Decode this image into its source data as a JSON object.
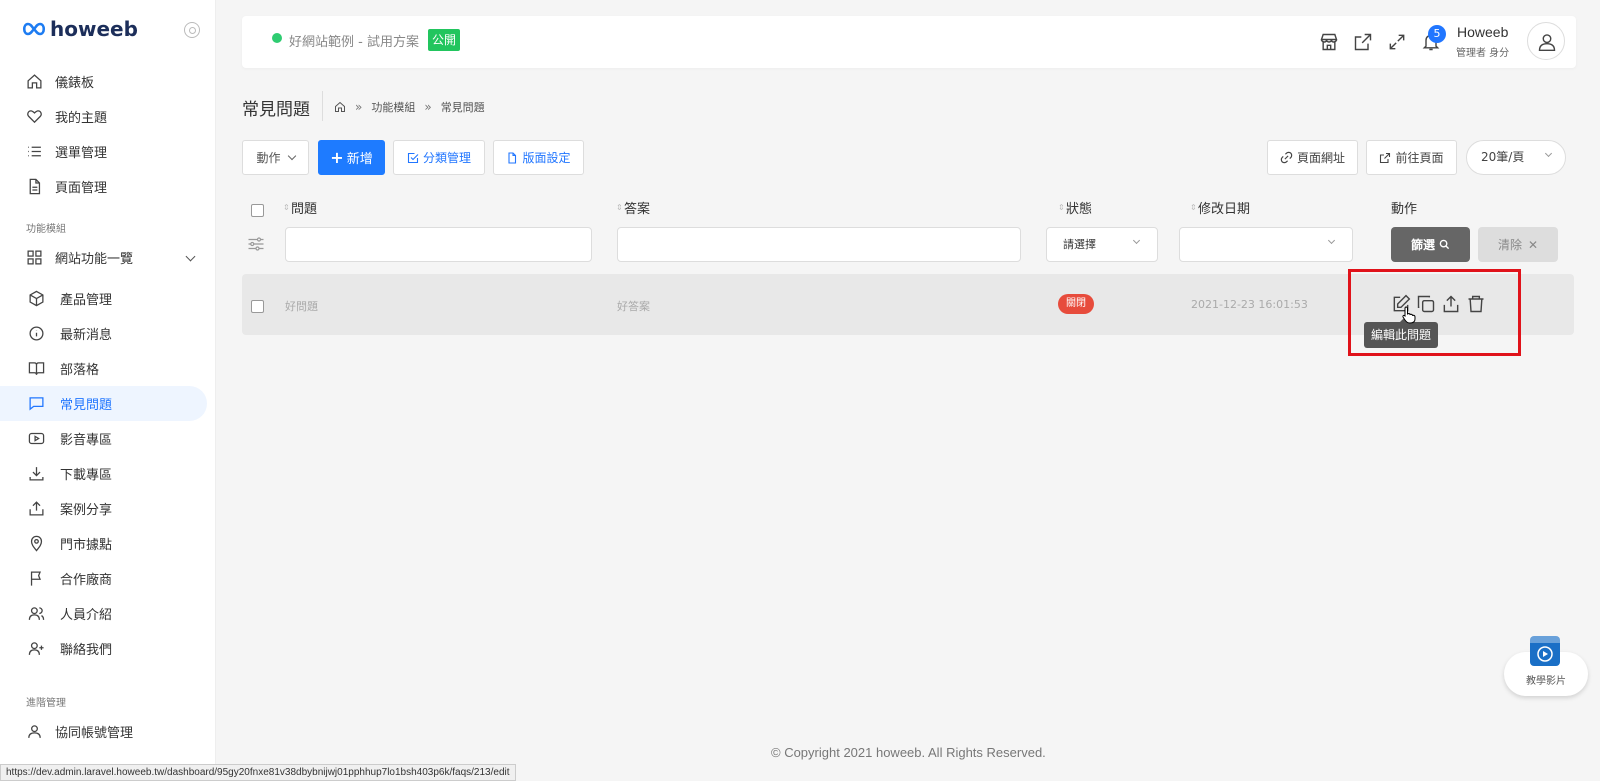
{
  "brand": {
    "name": "howeeb"
  },
  "sidebar": {
    "main": [
      {
        "label": "儀錶板",
        "icon": "home-icon"
      },
      {
        "label": "我的主題",
        "icon": "heart-icon"
      },
      {
        "label": "選單管理",
        "icon": "list-icon"
      },
      {
        "label": "頁面管理",
        "icon": "file-icon"
      }
    ],
    "section_modules": "功能模組",
    "modules_group": "網站功能一覽",
    "modules": [
      {
        "label": "產品管理",
        "icon": "box-icon"
      },
      {
        "label": "最新消息",
        "icon": "info-icon"
      },
      {
        "label": "部落格",
        "icon": "book-icon"
      },
      {
        "label": "常見問題",
        "icon": "chat-icon"
      },
      {
        "label": "影音專區",
        "icon": "video-icon"
      },
      {
        "label": "下載專區",
        "icon": "download-icon"
      },
      {
        "label": "案例分享",
        "icon": "share-icon"
      },
      {
        "label": "門市據點",
        "icon": "map-pin-icon"
      },
      {
        "label": "合作廠商",
        "icon": "flag-icon"
      },
      {
        "label": "人員介紹",
        "icon": "users-icon"
      },
      {
        "label": "聯絡我們",
        "icon": "user-plus-icon"
      }
    ],
    "active": "常見問題",
    "section_advanced": "進階管理",
    "advanced": [
      {
        "label": "協同帳號管理",
        "icon": "user-icon"
      }
    ]
  },
  "topbar": {
    "site_name": "好網站範例 - 試用方案",
    "publish_badge": "公開",
    "notification_count": "5",
    "user_name": "Howeeb",
    "user_role": "管理者 身分",
    "status_color": "#2ecc71"
  },
  "header": {
    "title": "常見問題",
    "breadcrumb": [
      "功能模組",
      "常見問題"
    ]
  },
  "toolbar": {
    "action_label": "動作",
    "add_label": "新增",
    "category_label": "分類管理",
    "layout_label": "版面設定",
    "page_url_label": "頁面網址",
    "goto_page_label": "前往頁面",
    "per_page": "20筆/頁"
  },
  "table": {
    "columns": [
      "問題",
      "答案",
      "狀態",
      "修改日期",
      "動作"
    ],
    "filter": {
      "status_placeholder": "請選擇",
      "filter_button": "篩選",
      "clear_button": "清除"
    },
    "rows": [
      {
        "question": "好問題",
        "answer": "好答案",
        "status": "關閉",
        "modified": "2021-12-23 16:01:53"
      }
    ],
    "row_actions": [
      "edit-icon",
      "copy-icon",
      "upload-icon",
      "trash-icon"
    ],
    "tooltip": "編輯此問題"
  },
  "footer": {
    "copyright": "© Copyright 2021 howeeb. All Rights Reserved."
  },
  "status_bar": {
    "url": "https://dev.admin.laravel.howeeb.tw/dashboard/95gy20fnxe81v38dbybnijwj01pphhup7lo1bsh403p6k/faqs/213/edit"
  },
  "tutorial": {
    "label": "教學影片"
  },
  "colors": {
    "primary": "#1e7bff",
    "danger": "#e74c3c",
    "publish": "#22c55e"
  }
}
